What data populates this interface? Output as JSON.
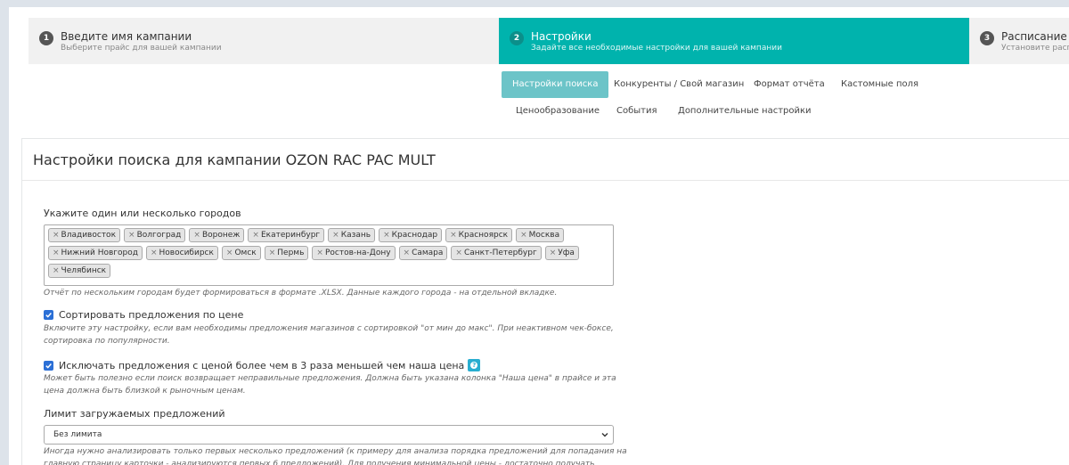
{
  "steps": [
    {
      "num": "1",
      "title": "Введите имя кампании",
      "subtitle": "Выберите прайс для вашей кампании"
    },
    {
      "num": "2",
      "title": "Настройки",
      "subtitle": "Задайте все необходимые настройки для вашей кампании"
    },
    {
      "num": "3",
      "title": "Расписание",
      "subtitle": "Установите распис"
    }
  ],
  "tabs": {
    "search": "Настройки поиска",
    "competitors": "Конкуренты / Свой магазин",
    "report": "Формат отчёта",
    "custom": "Кастомные поля",
    "pricing": "Ценообразование",
    "events": "События",
    "extra": "Дополнительные настройки"
  },
  "panel": {
    "title": "Настройки поиска для кампании OZON RAC PAC MULT"
  },
  "cities": {
    "label": "Укажите один или несколько городов",
    "chip_remove": "×",
    "items": [
      "Владивосток",
      "Волгоград",
      "Воронеж",
      "Екатеринбург",
      "Казань",
      "Краснодар",
      "Красноярск",
      "Москва",
      "Нижний Новгород",
      "Новосибирск",
      "Омск",
      "Пермь",
      "Ростов-на-Дону",
      "Самара",
      "Санкт-Петербург",
      "Уфа",
      "Челябинск"
    ],
    "hint": "Отчёт по нескольким городам будет формироваться в формате .XLSX. Данные каждого города - на отдельной вкладке."
  },
  "sort_option": {
    "checked": true,
    "label": "Сортировать предложения по цене",
    "hint_line1": "Включите эту настройку, если вам необходимы предложения магазинов с сортировкой \"от мин до макс\". При неактивном чек-боксе,",
    "hint_line2": "сортировка по популярности."
  },
  "exclude_option": {
    "checked": true,
    "label": "Исключать предложения с ценой более чем в 3 раза меньшей чем наша цена",
    "help": "?",
    "hint_line1": "Может быть полезно если поиск возвращает неправильные предложения. Должна быть указана колонка \"Наша цена\" в прайсе и эта",
    "hint_line2": "цена должна быть близкой к рыночным ценам."
  },
  "limit": {
    "label": "Лимит загружаемых предложений",
    "selected": "Без лимита",
    "hint_line1": "Иногда нужно анализировать только первых несколько предложений (к примеру для анализа порядка предложений для попадания на",
    "hint_line2": "главную страницу карточки - анализируются первых 6 предложений). Для получения минимальной цены - достаточно получать"
  },
  "colors": {
    "active_step": "#00b3ad",
    "active_tab": "#6cc4c8",
    "checkbox": "#2b6fd6",
    "help_badge": "#29aed0"
  }
}
